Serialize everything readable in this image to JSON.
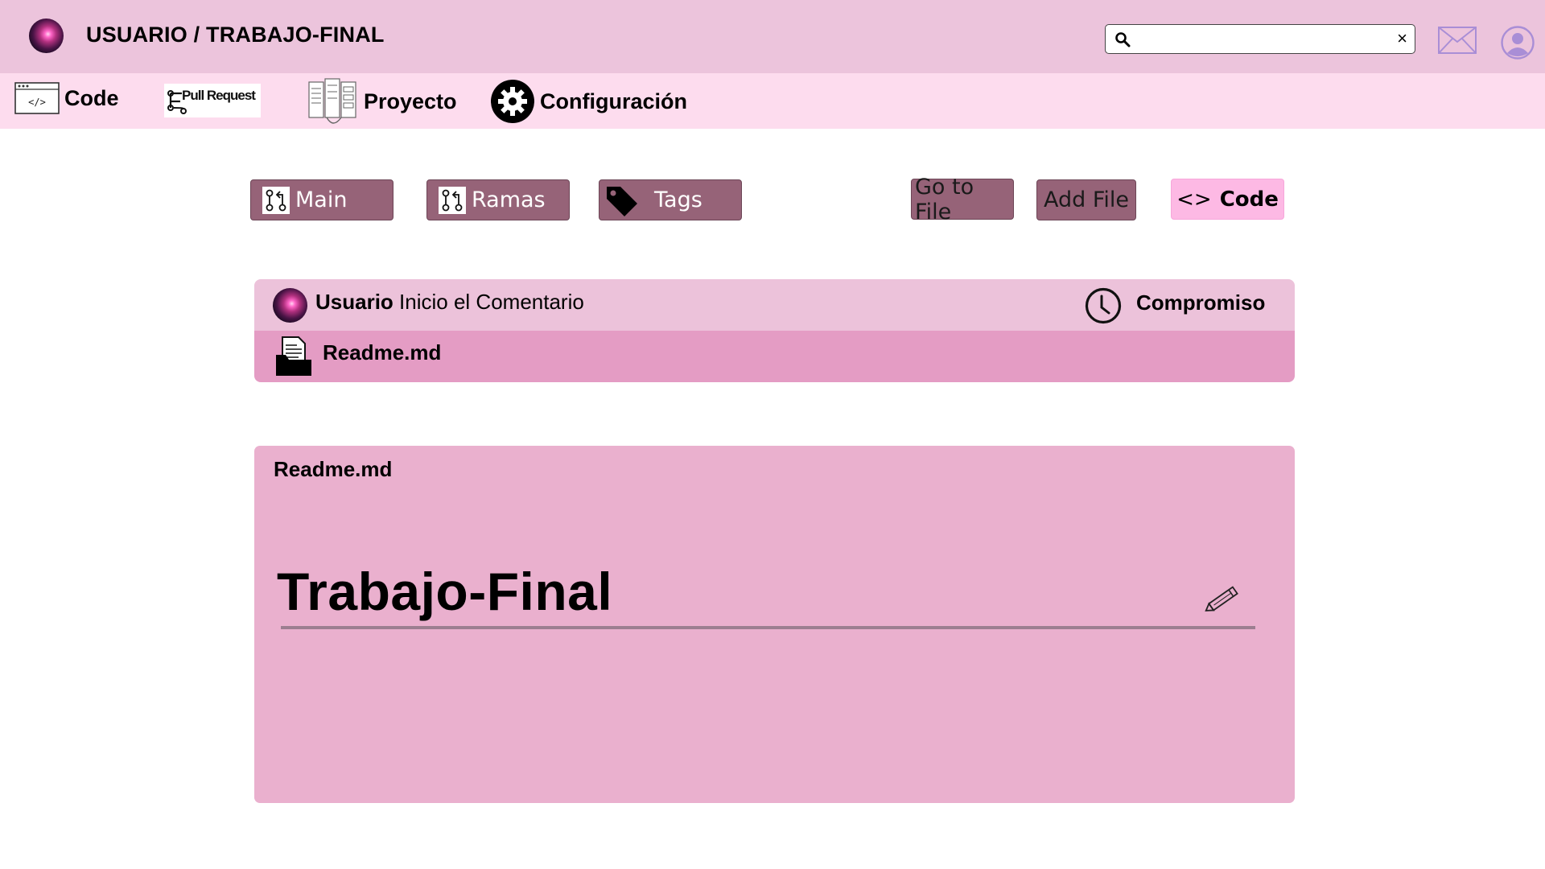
{
  "header": {
    "user": "USUARIO /",
    "repo": "TRABAJO-FINAL",
    "search": {
      "value": "",
      "placeholder": ""
    },
    "icons": [
      "galaxy-avatar",
      "search-icon",
      "close-icon",
      "mail-icon",
      "profile-icon"
    ]
  },
  "nav": {
    "code": "Code",
    "pull_request": "Pull Request",
    "proyecto": "Proyecto",
    "configuracion": "Configuración"
  },
  "toolbar": {
    "main": "Main",
    "ramas": "Ramas",
    "tags": "Tags",
    "go_to_file": "Go to File",
    "add_file": "Add File",
    "code_symbol": "<>",
    "code": "Code"
  },
  "commit": {
    "user": "Usuario",
    "message": "Inicio el Comentario",
    "compromiso": "Compromiso",
    "file": "Readme.md"
  },
  "readme": {
    "filename": "Readme.md",
    "heading": "Trabajo-Final"
  },
  "colors": {
    "topbar": "#ecc4dc",
    "navbar": "#fddcee",
    "button": "#966378",
    "code_button": "#fdb9e4",
    "readme_panel": "#eab0ce"
  }
}
